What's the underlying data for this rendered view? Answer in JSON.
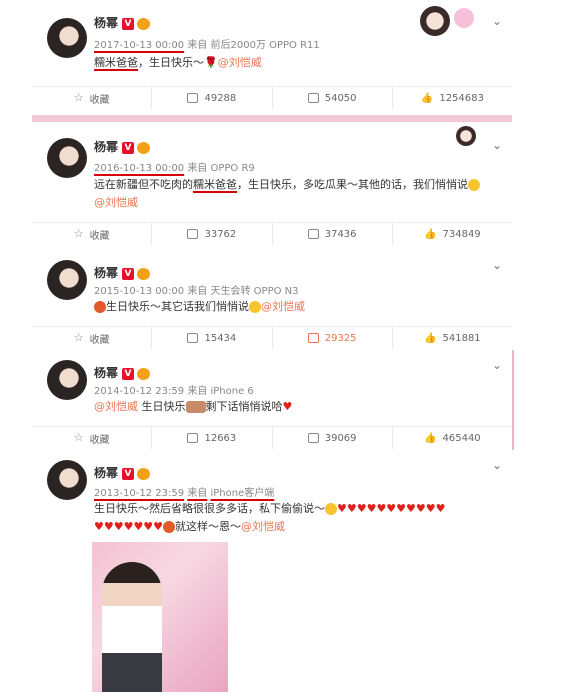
{
  "posts": [
    {
      "name": "杨幂",
      "time": "2017-10-13 00:00",
      "source_prefix": "来自",
      "source": "前后2000万 OPPO R11",
      "content_a": "糯米爸爸",
      "content_b": "，生日快乐～",
      "mention": "@刘恺威",
      "favorite": "收藏",
      "reposts": "49288",
      "comments": "54050",
      "likes": "1254683"
    },
    {
      "name": "杨幂",
      "time": "2016-10-13 00:00",
      "source_prefix": "来自",
      "source": "OPPO R9",
      "content_a": "远在新疆但不吃肉的",
      "content_b": "糯米爸爸",
      "content_c": "，生日快乐，多吃瓜果～其他的话，我们悄悄说",
      "mention": "@刘恺威",
      "favorite": "收藏",
      "reposts": "33762",
      "comments": "37436",
      "likes": "734849"
    },
    {
      "name": "杨幂",
      "time": "2015-10-13 00:00",
      "source_prefix": "来自",
      "source": "天生会转 OPPO N3",
      "content_a": "生日快乐～其它话我们悄悄说",
      "mention": "@刘恺威",
      "favorite": "收藏",
      "reposts": "15434",
      "comments": "29325",
      "likes": "541881"
    },
    {
      "name": "杨幂",
      "time": "2014-10-12 23:59",
      "source_prefix": "来自",
      "source": "iPhone 6",
      "mention": "@刘恺威",
      "content_a": "生日快乐",
      "content_b": "剩下话悄悄说哈",
      "favorite": "收藏",
      "reposts": "12663",
      "comments": "39069",
      "likes": "465440"
    },
    {
      "name": "杨幂",
      "time": "2013-10-12 23:59",
      "source_prefix": "来自",
      "source": "iPhone客户端",
      "content_a": "生日快乐～然后省略很很多多话，私下偷偷说～",
      "content_b": "就这样～恩～",
      "mention": "@刘恺威"
    }
  ],
  "colors": {
    "brand_link": "#eb7350",
    "underline": "#d9000b",
    "divider": "#f5c8d7",
    "verified": "#e8102b"
  },
  "icons": {
    "favorite": "star-icon",
    "repost": "repost-icon",
    "comment": "comment-icon",
    "like": "thumbs-up-icon",
    "more": "chevron-down-icon"
  }
}
